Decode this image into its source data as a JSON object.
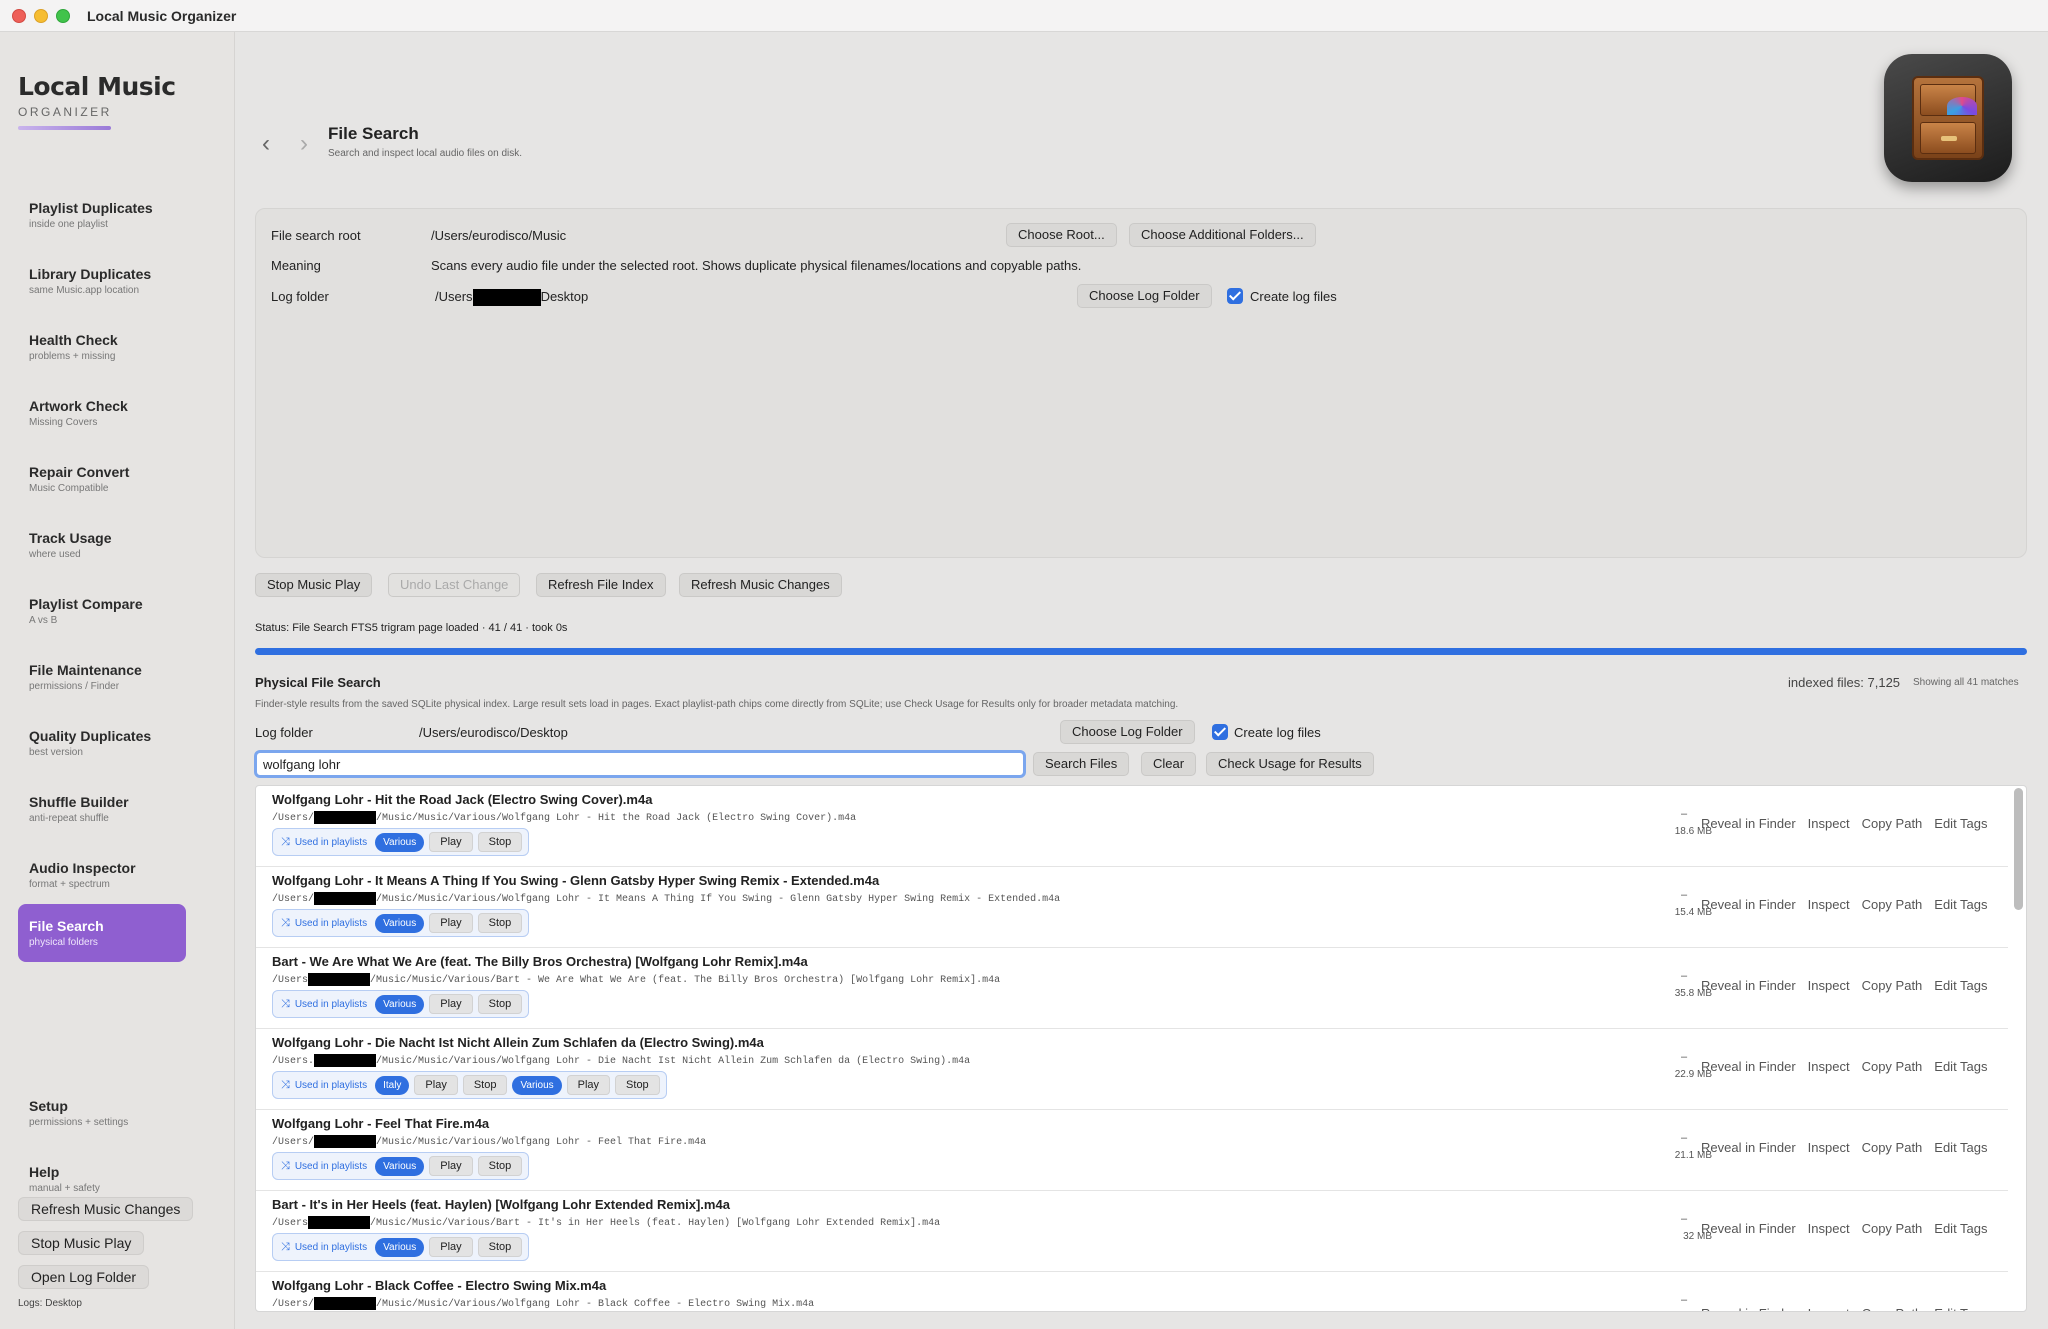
{
  "window": {
    "title": "Local Music Organizer"
  },
  "brand": {
    "title": "Local Music",
    "subtitle": "ORGANIZER"
  },
  "sidebar": {
    "items": [
      {
        "title": "Playlist Duplicates",
        "subtitle": "inside one playlist"
      },
      {
        "title": "Library Duplicates",
        "subtitle": "same Music.app location"
      },
      {
        "title": "Health Check",
        "subtitle": "problems + missing"
      },
      {
        "title": "Artwork Check",
        "subtitle": "Missing Covers"
      },
      {
        "title": "Repair Convert",
        "subtitle": "Music Compatible"
      },
      {
        "title": "Track Usage",
        "subtitle": "where used"
      },
      {
        "title": "Playlist Compare",
        "subtitle": "A vs B"
      },
      {
        "title": "File Maintenance",
        "subtitle": "permissions / Finder"
      },
      {
        "title": "Quality Duplicates",
        "subtitle": "best version"
      },
      {
        "title": "Shuffle Builder",
        "subtitle": "anti-repeat shuffle"
      },
      {
        "title": "Audio Inspector",
        "subtitle": "format + spectrum"
      },
      {
        "title": "File Search",
        "subtitle": "physical folders"
      }
    ],
    "bottom": [
      {
        "title": "Setup",
        "subtitle": "permissions + settings"
      },
      {
        "title": "Help",
        "subtitle": "manual + safety"
      }
    ],
    "buttons": {
      "refresh": "Refresh Music Changes",
      "stop": "Stop Music Play",
      "open_log": "Open Log Folder"
    },
    "logs_note": "Logs: Desktop"
  },
  "header": {
    "back": "‹",
    "forward": "›",
    "title": "File Search",
    "subtitle": "Search and inspect local audio files on disk."
  },
  "settings": {
    "root_label": "File search root",
    "root_value": "/Users/eurodisco/Music",
    "choose_root": "Choose Root...",
    "choose_additional": "Choose Additional Folders...",
    "meaning_label": "Meaning",
    "meaning_value": "Scans every audio file under the selected root. Shows duplicate physical filenames/locations and copyable paths.",
    "log_label": "Log folder",
    "log_prefix": "/Users",
    "log_suffix": "Desktop",
    "choose_log": "Choose Log Folder",
    "create_log": "Create log files"
  },
  "actions": {
    "stop": "Stop Music Play",
    "undo": "Undo Last Change",
    "refresh_index": "Refresh File Index",
    "refresh_changes": "Refresh Music Changes"
  },
  "status": "Status: File Search FTS5 trigram page loaded · 41 / 41 · took 0s",
  "progress": 1.0,
  "search": {
    "title": "Physical File Search",
    "subtitle": "Finder-style results from the saved SQLite physical index. Large result sets load in pages. Exact playlist-path chips come directly from SQLite; use Check Usage for Results only for broader metadata matching.",
    "indexed": "indexed files: 7,125",
    "showing": "Showing all 41 matches",
    "log_label": "Log folder",
    "log_value": "/Users/eurodisco/Desktop",
    "choose_log": "Choose Log Folder",
    "create_log": "Create log files",
    "query": "wolfgang lohr",
    "search_btn": "Search Files",
    "clear_btn": "Clear",
    "check_btn": "Check Usage for Results"
  },
  "row_labels": {
    "used": "Used in playlists",
    "play": "Play",
    "stop": "Stop",
    "reveal": "Reveal in Finder",
    "inspect": "Inspect",
    "copy": "Copy Path",
    "edit": "Edit Tags",
    "dash": "–"
  },
  "results": [
    {
      "name": "Wolfgang Lohr - Hit the Road Jack (Electro Swing Cover).m4a",
      "path_pre": "/Users/",
      "path_post": "/Music/Music/Various/Wolfgang Lohr - Hit the Road Jack (Electro Swing Cover).m4a",
      "size": "18.6 MB",
      "playlists": [
        "Various"
      ]
    },
    {
      "name": "Wolfgang Lohr - It Means A Thing If You Swing - Glenn Gatsby Hyper Swing Remix - Extended.m4a",
      "path_pre": "/Users/",
      "path_post": "/Music/Music/Various/Wolfgang Lohr - It Means A Thing If You Swing - Glenn Gatsby Hyper Swing Remix - Extended.m4a",
      "size": "15.4 MB",
      "playlists": [
        "Various"
      ]
    },
    {
      "name": "Bart - We Are What We Are (feat. The Billy Bros Orchestra) [Wolfgang Lohr Remix].m4a",
      "path_pre": "/Users",
      "path_post": "/Music/Music/Various/Bart - We Are What We Are (feat. The Billy Bros Orchestra) [Wolfgang Lohr Remix].m4a",
      "size": "35.8 MB",
      "playlists": [
        "Various"
      ]
    },
    {
      "name": "Wolfgang Lohr - Die Nacht Ist Nicht Allein Zum Schlafen da (Electro Swing).m4a",
      "path_pre": "/Users.",
      "path_post": "/Music/Music/Various/Wolfgang Lohr - Die Nacht Ist Nicht Allein Zum Schlafen da (Electro Swing).m4a",
      "size": "22.9 MB",
      "playlists": [
        "Italy",
        "Various"
      ]
    },
    {
      "name": "Wolfgang Lohr - Feel That Fire.m4a",
      "path_pre": "/Users/",
      "path_post": "/Music/Music/Various/Wolfgang Lohr - Feel That Fire.m4a",
      "size": "21.1 MB",
      "playlists": [
        "Various"
      ]
    },
    {
      "name": "Bart - It's in Her Heels (feat. Haylen) [Wolfgang Lohr Extended Remix].m4a",
      "path_pre": "/Users",
      "path_post": "/Music/Music/Various/Bart - It's in Her Heels (feat. Haylen) [Wolfgang Lohr Extended Remix].m4a",
      "size": "32 MB",
      "playlists": [
        "Various"
      ]
    },
    {
      "name": "Wolfgang Lohr - Black Coffee - Electro Swing Mix.m4a",
      "path_pre": "/Users/",
      "path_post": "/Music/Music/Various/Wolfgang Lohr - Black Coffee - Electro Swing Mix.m4a",
      "size": "",
      "playlists": []
    }
  ]
}
